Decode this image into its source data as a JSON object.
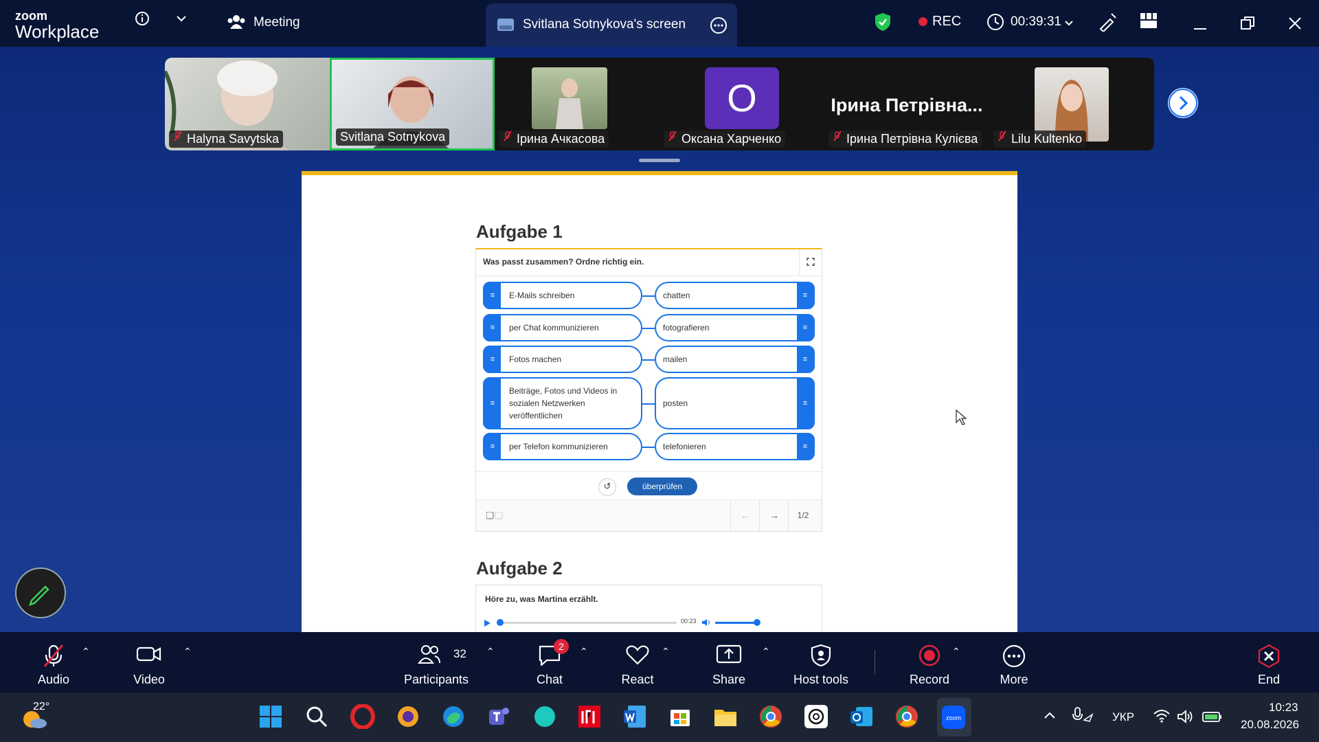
{
  "app": {
    "logo_top": "zoom",
    "logo_bottom": "Workplace"
  },
  "topbar": {
    "meeting_label": "Meeting",
    "share_tab_label": "Svitlana Sotnykova's screen",
    "rec_label": "REC",
    "timer": "00:39:31"
  },
  "participants": [
    {
      "name": "Halyna Savytska"
    },
    {
      "name": "Svitlana Sotnykova"
    },
    {
      "name": "Ірина Ачкасова"
    },
    {
      "name": "Оксана Харченко",
      "initial": "O"
    },
    {
      "name": "Ірина Петрівна Кулієва",
      "display": "Ірина  Петрівна..."
    },
    {
      "name": "Lilu Kultenko"
    }
  ],
  "shared": {
    "task1_title": "Aufgabe 1",
    "task1_question": "Was passt zusammen? Ordne richtig ein.",
    "pairs": [
      {
        "left": "E-Mails schreiben",
        "right": "chatten"
      },
      {
        "left": "per Chat kommunizieren",
        "right": "fotografieren"
      },
      {
        "left": "Fotos machen",
        "right": "mailen"
      },
      {
        "left": "Beiträge, Fotos und Videos in sozialen Netzwerken veröffentlichen",
        "right": "posten"
      },
      {
        "left": "per Telefon kommunizieren",
        "right": "telefonieren"
      }
    ],
    "check_label": "überprüfen",
    "page_counter": "1/2",
    "task2_title": "Aufgabe 2",
    "task2_question": "Höre zu, was Martina erzählt.",
    "audio_time": "00:23"
  },
  "toolbar": {
    "audio": "Audio",
    "video": "Video",
    "participants": "Participants",
    "participants_count": "32",
    "chat": "Chat",
    "chat_badge": "2",
    "react": "React",
    "share": "Share",
    "host_tools": "Host tools",
    "record": "Record",
    "more": "More",
    "end": "End"
  },
  "taskbar": {
    "weather": "22°",
    "lang": "УКР",
    "time": "10:23",
    "date": "20.08.2026"
  },
  "colors": {
    "accent": "#1a73e8",
    "rec_red": "#e0243a",
    "doc_top": "#f0b91a"
  }
}
